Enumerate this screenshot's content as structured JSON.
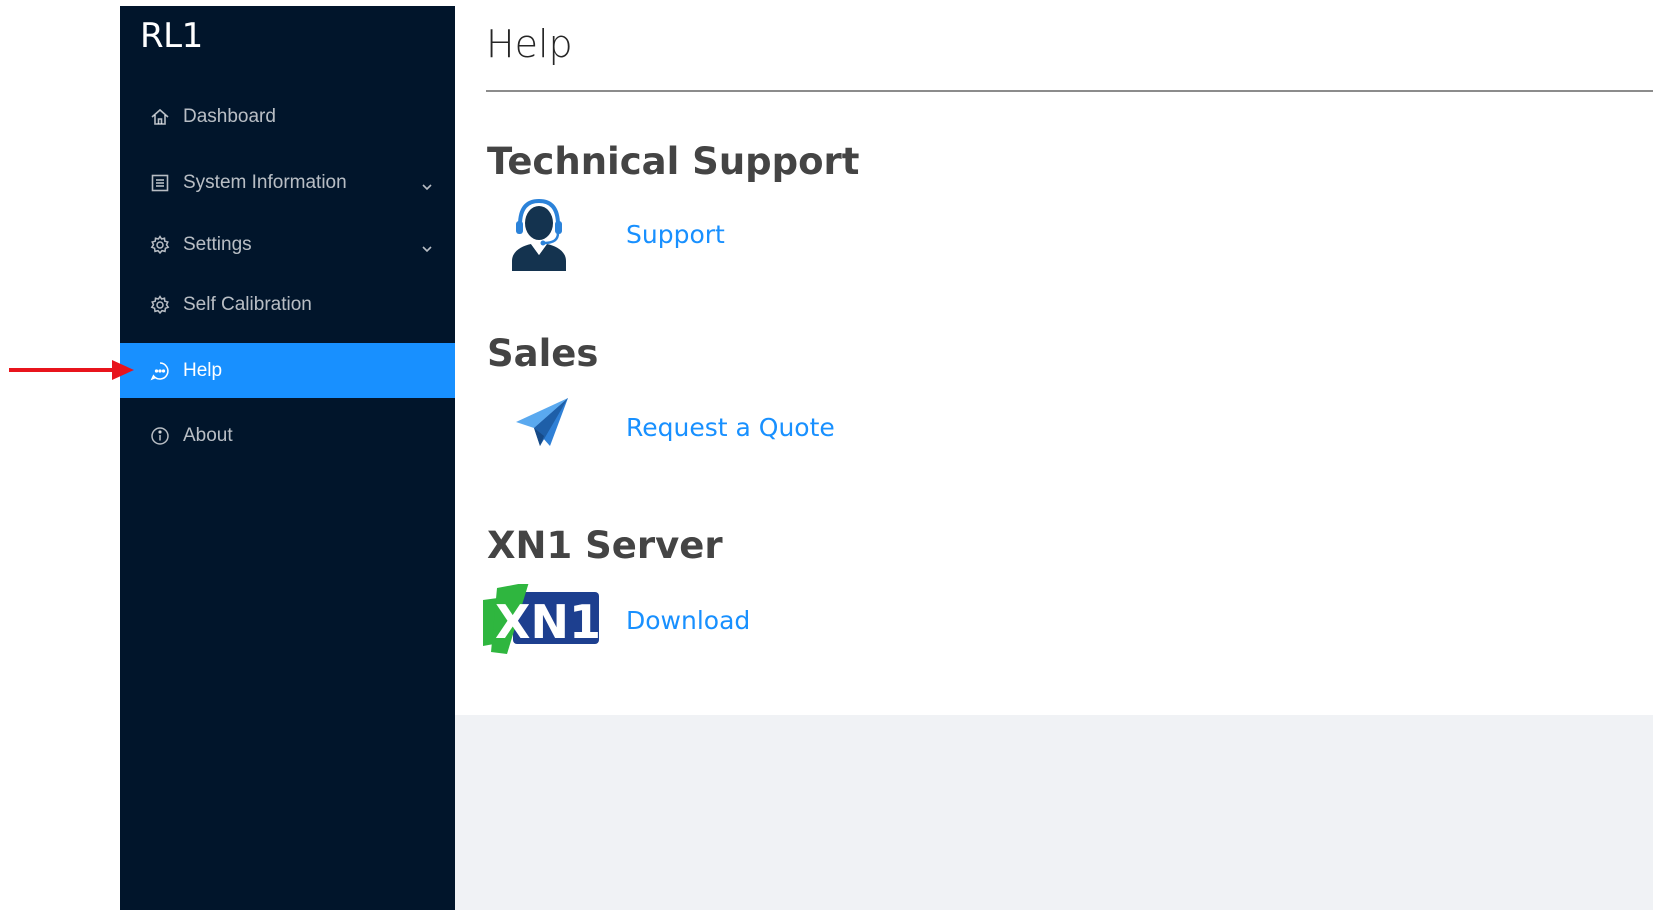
{
  "app": {
    "title": "RL1"
  },
  "sidebar": {
    "items": [
      {
        "label": "Dashboard",
        "icon": "home-icon",
        "has_submenu": false,
        "active": false
      },
      {
        "label": "System Information",
        "icon": "list-icon",
        "has_submenu": true,
        "active": false
      },
      {
        "label": "Settings",
        "icon": "gear-icon",
        "has_submenu": true,
        "active": false
      },
      {
        "label": "Self Calibration",
        "icon": "gear-icon",
        "has_submenu": false,
        "active": false
      },
      {
        "label": "Help",
        "icon": "chat-icon",
        "has_submenu": false,
        "active": true
      },
      {
        "label": "About",
        "icon": "info-icon",
        "has_submenu": false,
        "active": false
      }
    ]
  },
  "main": {
    "title": "Help",
    "sections": [
      {
        "title": "Technical Support",
        "link": "Support",
        "icon": "headset-agent-icon"
      },
      {
        "title": "Sales",
        "link": "Request a Quote",
        "icon": "paper-plane-icon"
      },
      {
        "title": "XN1 Server",
        "link": "Download",
        "icon": "xn1-logo"
      }
    ],
    "xn1_logo_text": "XN1"
  },
  "colors": {
    "sidebar_bg": "#01152b",
    "active_bg": "#1890ff",
    "link": "#1890ff",
    "annotation_arrow": "#e8141c"
  }
}
